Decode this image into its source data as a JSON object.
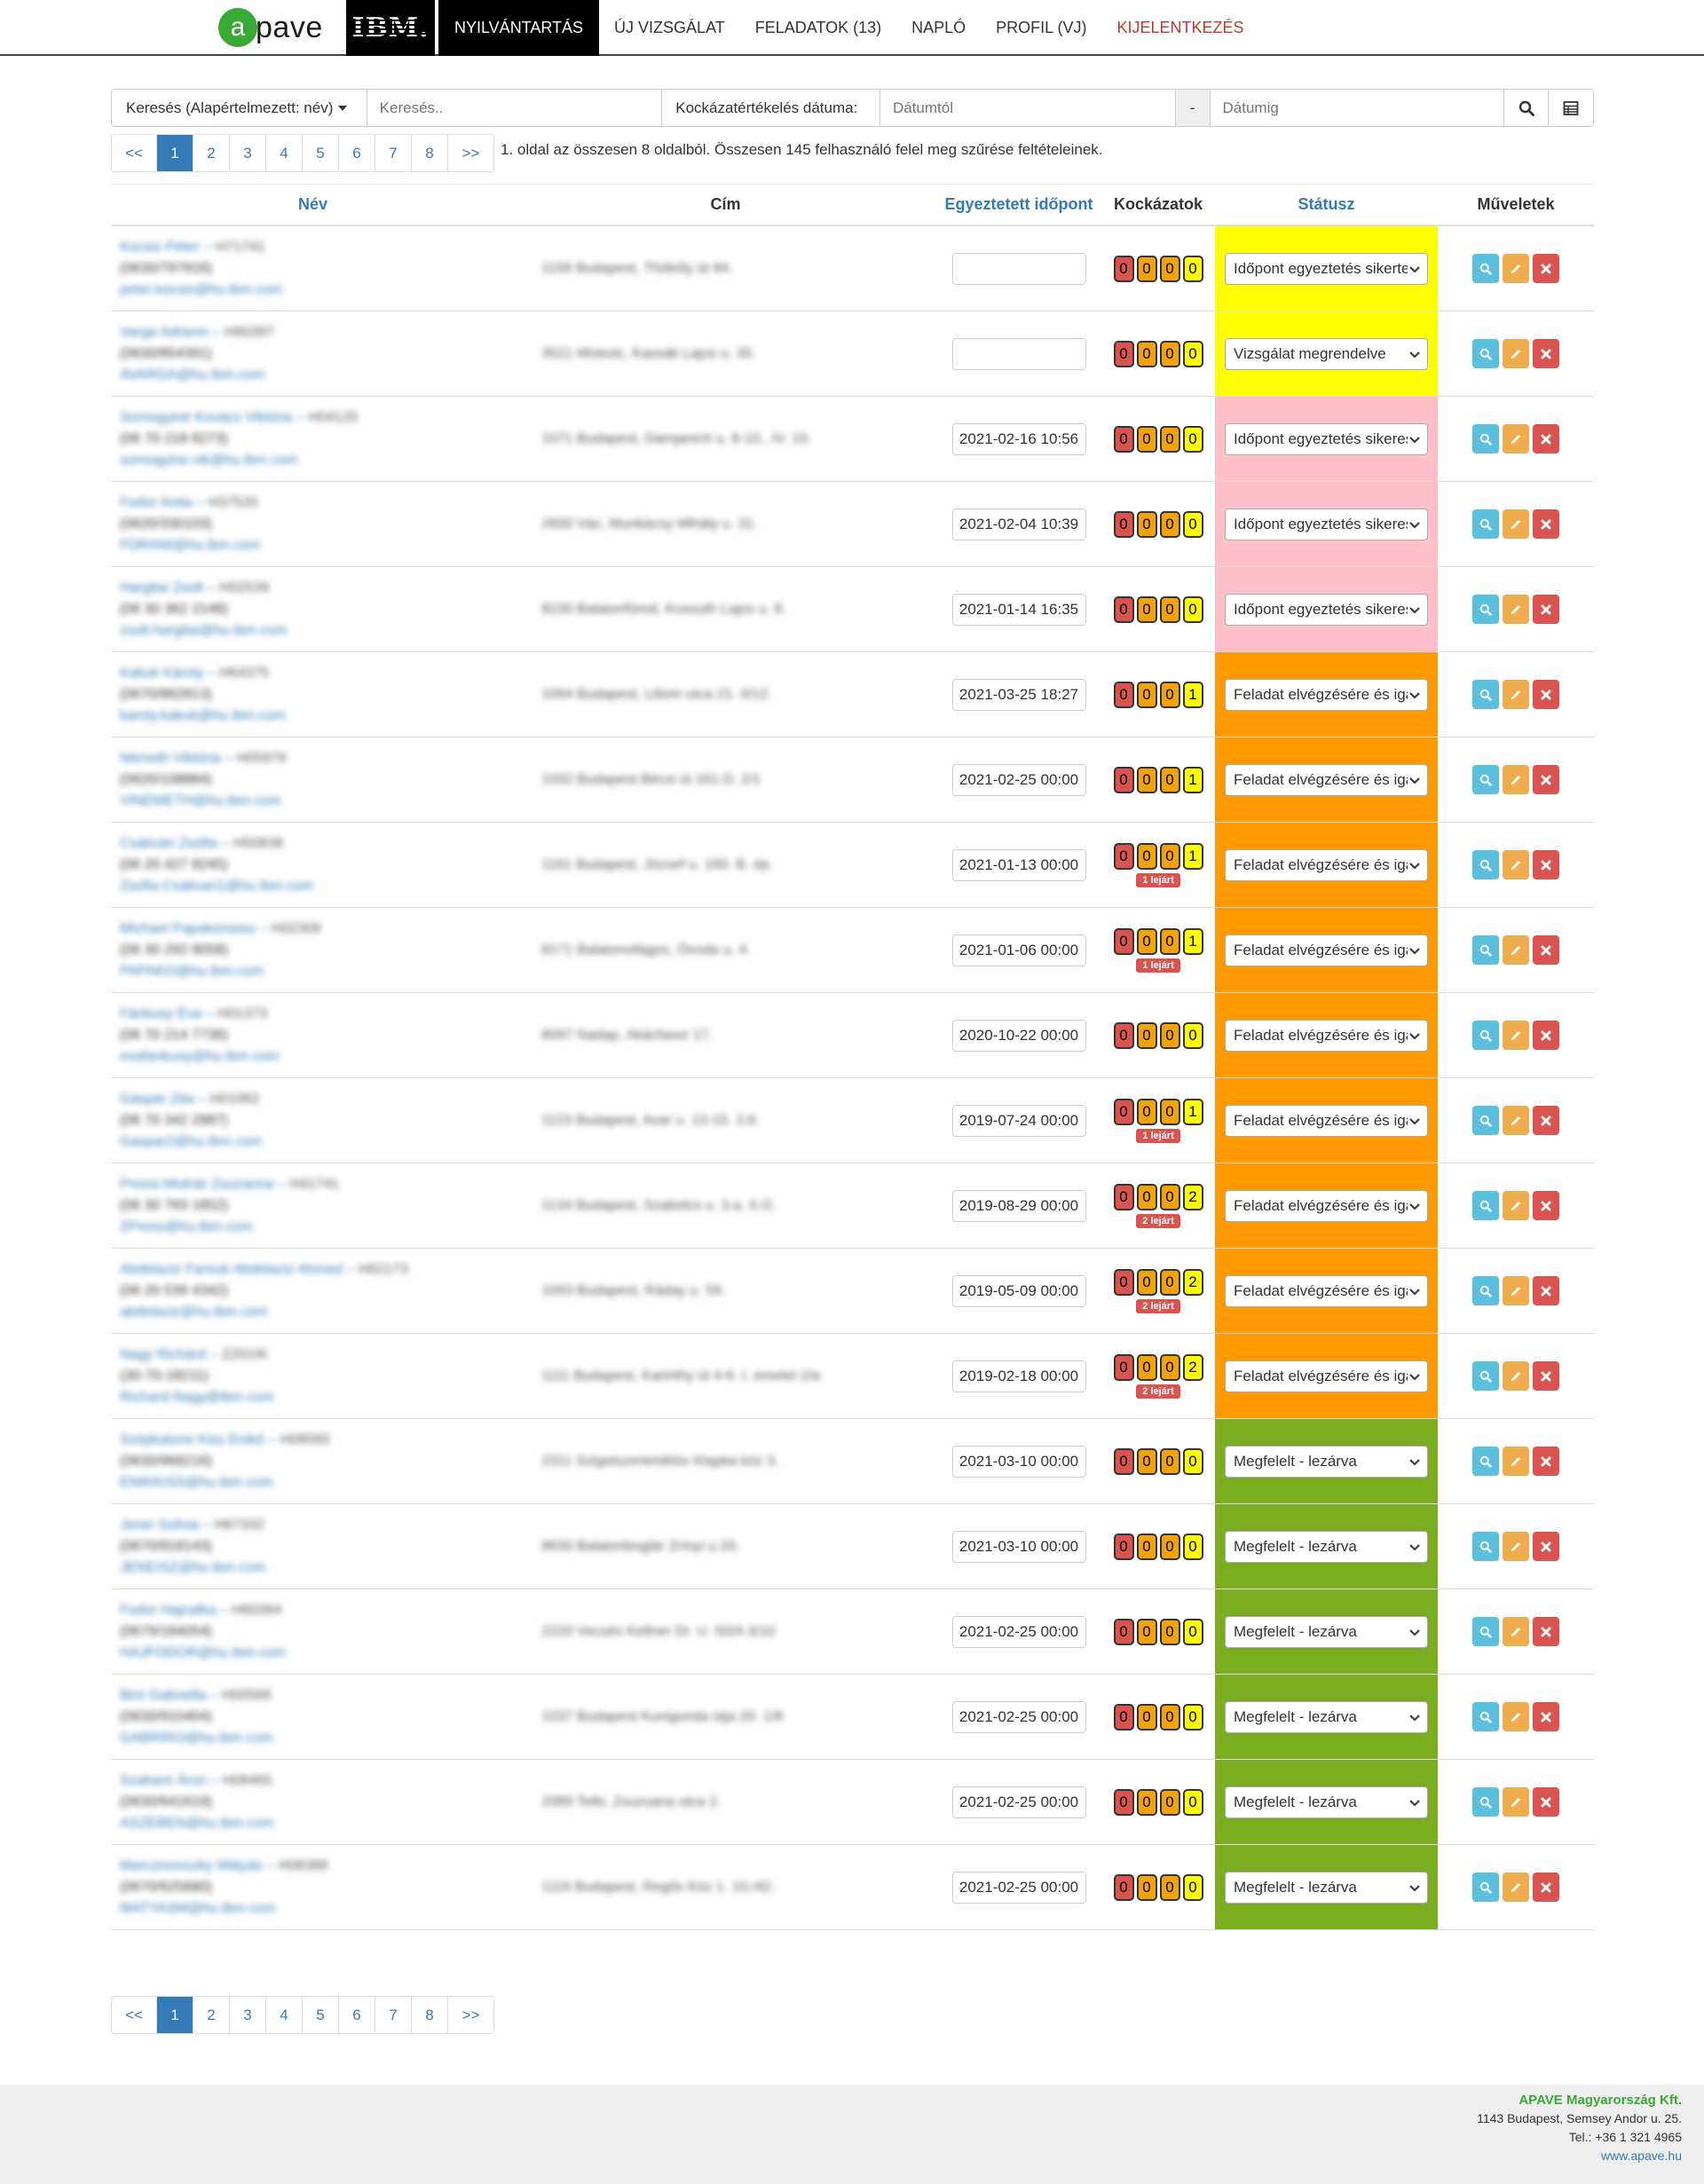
{
  "nav": {
    "apave_letter": "a",
    "apave_text": "pave",
    "ibm": "IBM.",
    "items": [
      {
        "label": "NYILVÁNTARTÁS",
        "active": true
      },
      {
        "label": "ÚJ VIZSGÁLAT"
      },
      {
        "label": "FELADATOK (13)"
      },
      {
        "label": "NAPLÓ"
      },
      {
        "label": "PROFIL (VJ)"
      },
      {
        "label": "KIJELENTKEZÉS"
      }
    ]
  },
  "search": {
    "dropdown_label": "Keresés (Alapértelmezett: név)",
    "search_placeholder": "Keresés..",
    "date_label": "Kockázatértékelés dátuma:",
    "from_placeholder": "Dátumtól",
    "dash": "-",
    "to_placeholder": "Dátumig"
  },
  "pagination": {
    "prev": "<<",
    "next": ">>",
    "pages": [
      "1",
      "2",
      "3",
      "4",
      "5",
      "6",
      "7",
      "8"
    ],
    "active": "1",
    "info": "1. oldal az összesen 8 oldalból. Összesen 145 felhasználó felel meg szűrése feltételeinek."
  },
  "table": {
    "headers": {
      "name": "Név",
      "address": "Cím",
      "time": "Egyeztetett időpont",
      "risks": "Kockázatok",
      "status": "Státusz",
      "actions": "Műveletek"
    },
    "rows": [
      {
        "name": "Kocsis Péter",
        "id": "H71741",
        "phone": "(0630/797916)",
        "email": "peter.kocsis@hu.ibm.com",
        "address": "1158 Budapest, Thököly út 84.",
        "time": "",
        "risks": [
          "0",
          "0",
          "0",
          "0"
        ],
        "expired": "",
        "status": "Időpont egyeztetés sikertelen",
        "status_color": "yellow"
      },
      {
        "name": "Varga Adrienn",
        "id": "H60397",
        "phone": "(0630/854391)",
        "email": "AVARGA@hu.ibm.com",
        "address": "3521 Miskolc, Kassák Lajos u. 35.",
        "time": "",
        "risks": [
          "0",
          "0",
          "0",
          "0"
        ],
        "expired": "",
        "status": "Vizsgálat megrendelve",
        "status_color": "yellow"
      },
      {
        "name": "Somogyiné Kovács Viktória",
        "id": "H04125",
        "phone": "(06 70 218 8273)",
        "email": "somogyine.vik@hu.ibm.com",
        "address": "1071 Budapest, Damjanich u. 8-10., IV. 10.",
        "time": "2021-02-16 10:56",
        "risks": [
          "0",
          "0",
          "0",
          "0"
        ],
        "expired": "",
        "status": "Időpont egyeztetés sikeres",
        "status_color": "pink"
      },
      {
        "name": "Fodor Anita",
        "id": "H37520",
        "phone": "(0620/330103)",
        "email": "FDRANI@hu.ibm.com",
        "address": "2600 Vác, Munkácsy Mihály u. 31.",
        "time": "2021-02-04 10:39",
        "risks": [
          "0",
          "0",
          "0",
          "0"
        ],
        "expired": "",
        "status": "Időpont egyeztetés sikeres",
        "status_color": "pink"
      },
      {
        "name": "Hargitai Zsolt",
        "id": "H02539",
        "phone": "(06 30 362 2148)",
        "email": "zsolt.hargitai@hu.ibm.com",
        "address": "8230 Balatonfüred, Kossuth Lajos u. 8.",
        "time": "2021-01-14 16:35",
        "risks": [
          "0",
          "0",
          "0",
          "0"
        ],
        "expired": "",
        "status": "Időpont egyeztetés sikeres",
        "status_color": "pink"
      },
      {
        "name": "Kakuk Károly",
        "id": "H64375",
        "phone": "(0670/862813)",
        "email": "karoly.kakuk@hu.ibm.com",
        "address": "1094 Budapest, Liliom utca 21. II/12.",
        "time": "2021-03-25 18:27",
        "risks": [
          "0",
          "0",
          "0",
          "1"
        ],
        "expired": "",
        "status": "Feladat elvégzésére és igazolására vár",
        "status_color": "orange"
      },
      {
        "name": "Németh Viktória",
        "id": "H05979",
        "phone": "(0620/108884)",
        "email": "VINEMETH@hu.ibm.com",
        "address": "1032 Budapest Bécsi út 161.D. 2/1",
        "time": "2021-02-25 00:00",
        "risks": [
          "0",
          "0",
          "0",
          "1"
        ],
        "expired": "",
        "status": "Feladat elvégzésére és igazolására vár",
        "status_color": "orange"
      },
      {
        "name": "Csákvári Zsófia",
        "id": "H50838",
        "phone": "(06 20 427 8245)",
        "email": "Zsofia.Csakvari1@hu.ibm.com",
        "address": "1161 Budapest, József u. 160. B. ép.",
        "time": "2021-01-13 00:00",
        "risks": [
          "0",
          "0",
          "0",
          "1"
        ],
        "expired": "1 lejárt",
        "status": "Feladat elvégzésére és igazolására vár",
        "status_color": "orange"
      },
      {
        "name": "Michael Papakonstou",
        "id": "H02309",
        "phone": "(06 30 292 8058)",
        "email": "PAPAKO@hu.ibm.com",
        "address": "8171 Balatonvilágos, Óvoda u. 4.",
        "time": "2021-01-06 00:00",
        "risks": [
          "0",
          "0",
          "0",
          "1"
        ],
        "expired": "1 lejárt",
        "status": "Feladat elvégzésére és igazolására vár",
        "status_color": "orange"
      },
      {
        "name": "Fánkusy Éva",
        "id": "H01373",
        "phone": "(06 70 214 7736)",
        "email": "evafankusy@hu.ibm.com",
        "address": "8097 Nadap, Akácfasor 17.",
        "time": "2020-10-22 00:00",
        "risks": [
          "0",
          "0",
          "0",
          "0"
        ],
        "expired": "",
        "status": "Feladat elvégzésére és igazolására vár",
        "status_color": "orange"
      },
      {
        "name": "Gáspár Zita",
        "id": "H01062",
        "phone": "(06 70 342 2887)",
        "email": "Gaspar2@hu.ibm.com",
        "address": "1123 Budapest, Avar u. 13-15. 3.6.",
        "time": "2019-07-24 00:00",
        "risks": [
          "0",
          "0",
          "0",
          "1"
        ],
        "expired": "1 lejárt",
        "status": "Feladat elvégzésére és igazolására vár",
        "status_color": "orange"
      },
      {
        "name": "Pressi-Molnár Zsuzanna",
        "id": "H41741",
        "phone": "(06 30 793 1852)",
        "email": "ZPress@hu.ibm.com",
        "address": "1134 Budapest, Szabolcs u. 3.a. II./2.",
        "time": "2019-08-29 00:00",
        "risks": [
          "0",
          "0",
          "0",
          "2"
        ],
        "expired": "2 lejárt",
        "status": "Feladat elvégzésére és igazolására vár",
        "status_color": "orange"
      },
      {
        "name": "Abdelaziz Farouk Abdelaziz Ahmed",
        "id": "H62173",
        "phone": "(06 20 539 4342)",
        "email": "abdelaziz@hu.ibm.com",
        "address": "1093 Budapest, Ráday u. 59.",
        "time": "2019-05-09 00:00",
        "risks": [
          "0",
          "0",
          "0",
          "2"
        ],
        "expired": "2 lejárt",
        "status": "Feladat elvégzésére és igazolására vár",
        "status_color": "orange"
      },
      {
        "name": "Nagy Richárd",
        "id": "ZZ01IK",
        "phone": "(30-70-18211)",
        "email": "Richard.Nagy@ibm.com",
        "address": "1111 Budapest, Karinthy út 4-6. I. emelet 2/a",
        "time": "2019-02-18 00:00",
        "risks": [
          "0",
          "0",
          "0",
          "2"
        ],
        "expired": "2 lejárt",
        "status": "Feladat elvégzésére és igazolására vár",
        "status_color": "orange"
      },
      {
        "name": "Szépkalone Kiss Enikő",
        "id": "H08565",
        "phone": "(0630/968216)",
        "email": "ENIKKISS@hu.ibm.com",
        "address": "2311 Szigetszentmiklós Klapka köz 3.",
        "time": "2021-03-10 00:00",
        "risks": [
          "0",
          "0",
          "0",
          "0"
        ],
        "expired": "",
        "status": "Megfelelt - lezárva",
        "status_color": "green"
      },
      {
        "name": "Jenei Szilvia",
        "id": "H67332",
        "phone": "(0670/818143)",
        "email": "JENEISZ@hu.ibm.com",
        "address": "8630 Balatonboglár Zrínyi u.33.",
        "time": "2021-03-10 00:00",
        "risks": [
          "0",
          "0",
          "0",
          "0"
        ],
        "expired": "",
        "status": "Megfelelt - lezárva",
        "status_color": "green"
      },
      {
        "name": "Fodor Hajnalka",
        "id": "H60394",
        "phone": "(0679/184054)",
        "email": "HAJFODOR@hu.ibm.com",
        "address": "2220 Vecsés Kellner Dr. U. 50/A 3/10",
        "time": "2021-02-25 00:00",
        "risks": [
          "0",
          "0",
          "0",
          "0"
        ],
        "expired": "",
        "status": "Megfelelt - lezárva",
        "status_color": "green"
      },
      {
        "name": "Biró Gabriella",
        "id": "H00566",
        "phone": "(0630/910404)",
        "email": "GABRIRO@hu.ibm.com",
        "address": "1037 Budapest Kunigunda útja 20. 1/8",
        "time": "2021-02-25 00:00",
        "risks": [
          "0",
          "0",
          "0",
          "0"
        ],
        "expired": "",
        "status": "Megfelelt - lezárva",
        "status_color": "green"
      },
      {
        "name": "Szabaró Áron",
        "id": "H08465",
        "phone": "(0630/641619)",
        "email": "ASZEBEN@hu.ibm.com",
        "address": "2089 Telki, Zsuzsana utca 2.",
        "time": "2021-02-25 00:00",
        "risks": [
          "0",
          "0",
          "0",
          "0"
        ],
        "expired": "",
        "status": "Megfelelt - lezárva",
        "status_color": "green"
      },
      {
        "name": "Marczinovszky Mátyás",
        "id": "H08388",
        "phone": "(0670/625680)",
        "email": "MATYASM@hu.ibm.com",
        "address": "1116 Budapest, Regős Köz 1. 10./42.",
        "time": "2021-02-25 00:00",
        "risks": [
          "0",
          "0",
          "0",
          "0"
        ],
        "expired": "",
        "status": "Megfelelt - lezárva",
        "status_color": "green"
      }
    ]
  },
  "footer": {
    "company": "APAVE Magyarország Kft.",
    "address": "1143 Budapest, Semsey Andor u. 25.",
    "phone": "Tel.: +36 1 321 4965",
    "web": "www.apave.hu"
  },
  "colors": {
    "yellow": "#ffff00",
    "pink": "#ffc0cb",
    "orange": "#ff9900",
    "green": "#7aad20",
    "link": "#337ab7",
    "brand_green": "#39a935"
  }
}
